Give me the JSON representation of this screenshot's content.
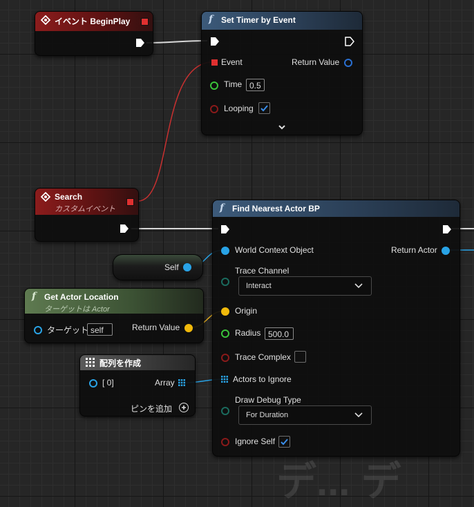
{
  "event_begin_play": {
    "title": "イベント BeginPlay"
  },
  "set_timer": {
    "title": "Set Timer by Event",
    "event_label": "Event",
    "return_label": "Return Value",
    "time_label": "Time",
    "time_value": "0.5",
    "looping_label": "Looping",
    "looping_checked": true
  },
  "search_event": {
    "title": "Search",
    "subtitle": "カスタムイベント"
  },
  "find_nearest": {
    "title": "Find Nearest Actor BP",
    "world_context_label": "World Context Object",
    "return_actor_label": "Return Actor",
    "trace_channel_label": "Trace Channel",
    "trace_channel_value": "Interact",
    "origin_label": "Origin",
    "radius_label": "Radius",
    "radius_value": "500.0",
    "trace_complex_label": "Trace Complex",
    "trace_complex_checked": false,
    "actors_ignore_label": "Actors to Ignore",
    "draw_debug_label": "Draw Debug Type",
    "draw_debug_value": "For Duration",
    "ignore_self_label": "Ignore Self",
    "ignore_self_checked": true
  },
  "self_node": {
    "label": "Self"
  },
  "get_actor_location": {
    "title": "Get Actor Location",
    "subtitle": "ターゲットは Actor",
    "target_label": "ターゲット",
    "target_value": "self",
    "return_label": "Return Value"
  },
  "make_array": {
    "title": "配列を作成",
    "index_label": "[ 0]",
    "array_label": "Array",
    "add_pin_label": "ピンを追加"
  },
  "background_text": "デ... デ"
}
